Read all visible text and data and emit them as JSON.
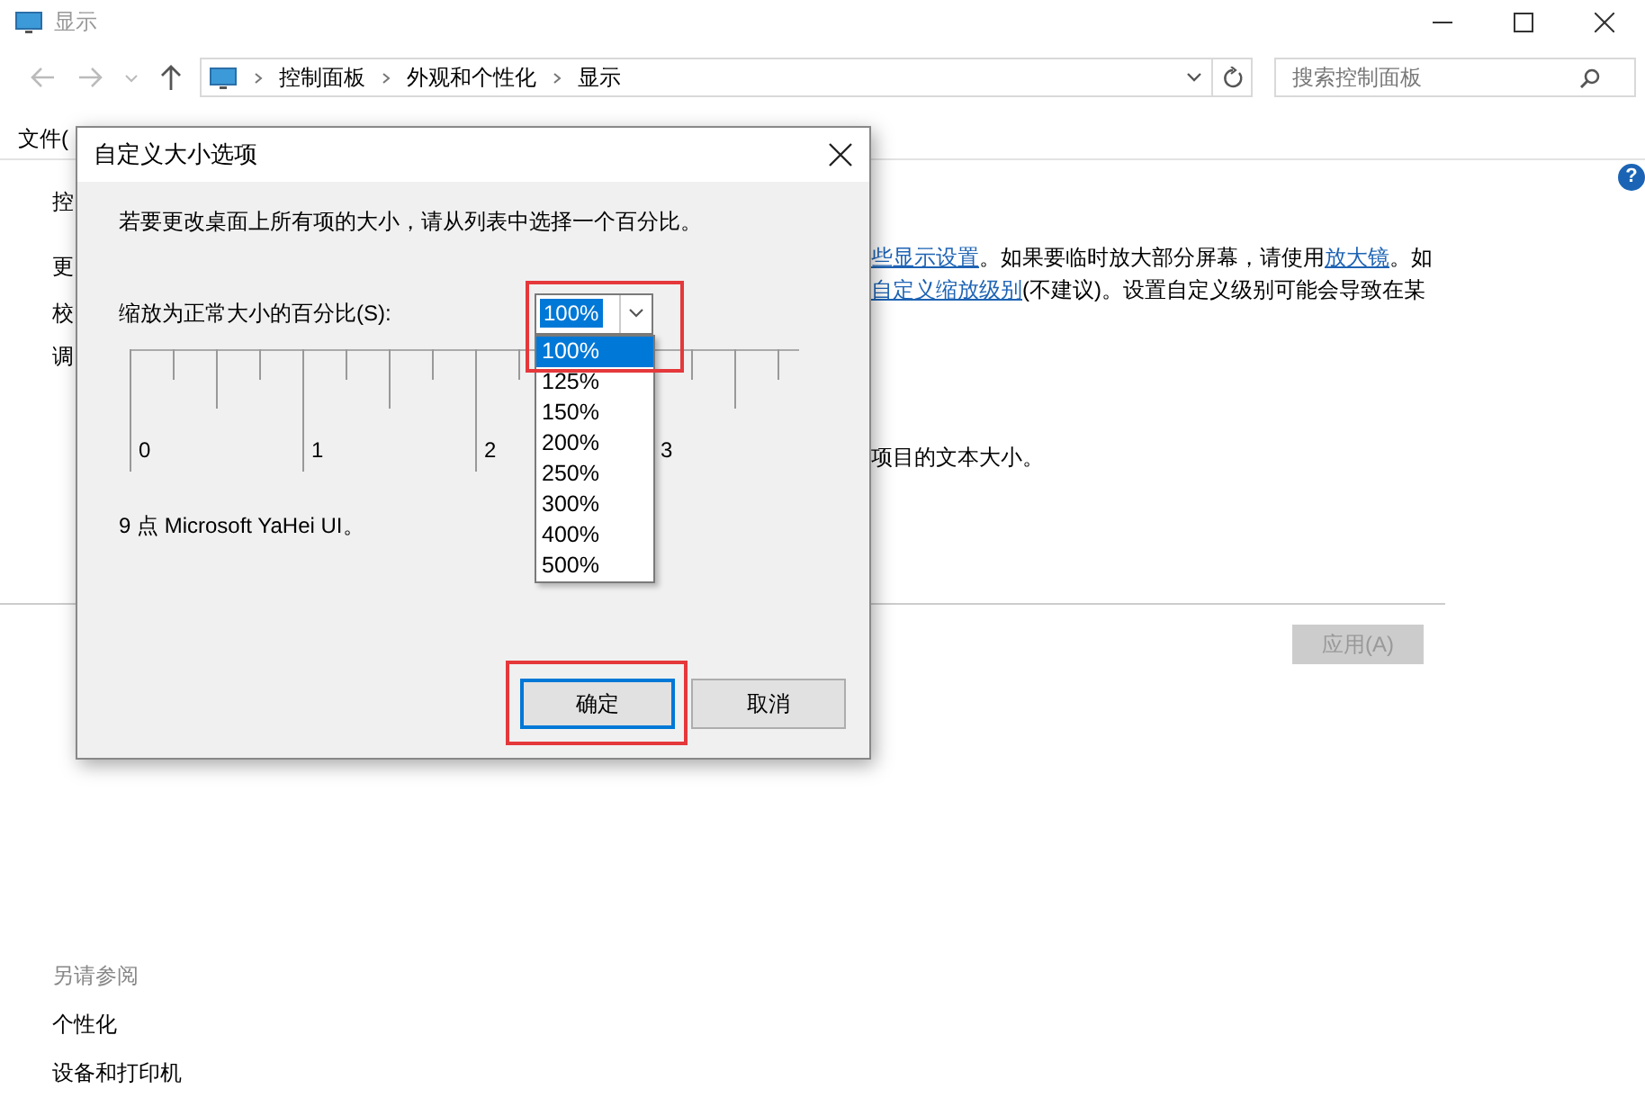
{
  "window": {
    "title": "显示"
  },
  "address_bar": {
    "breadcrumbs": [
      "控制面板",
      "外观和个性化",
      "显示"
    ]
  },
  "search": {
    "placeholder": "搜索控制面板"
  },
  "menu_bar": [
    "文件("
  ],
  "help": {
    "glyph": "?"
  },
  "content": {
    "left_fragments": [
      "控",
      "更",
      "校",
      "调"
    ],
    "paragraph_lines": [
      [
        {
          "text": "些显示设置",
          "kind": "link"
        },
        {
          "text": "。如果要临时放大部分屏幕，请使用",
          "kind": "plain"
        },
        {
          "text": "放大镜",
          "kind": "link"
        },
        {
          "text": "。如",
          "kind": "plain"
        }
      ],
      [
        {
          "text": "自定义缩放级别",
          "kind": "link"
        },
        {
          "text": "(不建议)。设置自定义级别可能会导致在某",
          "kind": "plain"
        }
      ]
    ],
    "note_line": "项目的文本大小。",
    "apply_button": {
      "label": "应用(A)",
      "disabled": true
    }
  },
  "see_also": {
    "heading": "另请参阅",
    "links": [
      "个性化",
      "设备和打印机"
    ]
  },
  "dialog": {
    "title": "自定义大小选项",
    "instruction": "若要更改桌面上所有项的大小，请从列表中选择一个百分比。",
    "scale_label": "缩放为正常大小的百分比(S):",
    "combo": {
      "value": "100%",
      "expanded": true,
      "options": [
        {
          "label": "100%",
          "selected": true
        },
        {
          "label": "125%",
          "selected": false
        },
        {
          "label": "150%",
          "selected": false
        },
        {
          "label": "200%",
          "selected": false
        },
        {
          "label": "250%",
          "selected": false
        },
        {
          "label": "300%",
          "selected": false
        },
        {
          "label": "400%",
          "selected": false
        },
        {
          "label": "500%",
          "selected": false
        }
      ]
    },
    "ruler_labels": [
      "0",
      "1",
      "2",
      "3"
    ],
    "font_sample": "9 点 Microsoft YaHei UI。",
    "buttons": [
      {
        "label": "确定",
        "default": true
      },
      {
        "label": "取消",
        "default": false
      }
    ]
  }
}
